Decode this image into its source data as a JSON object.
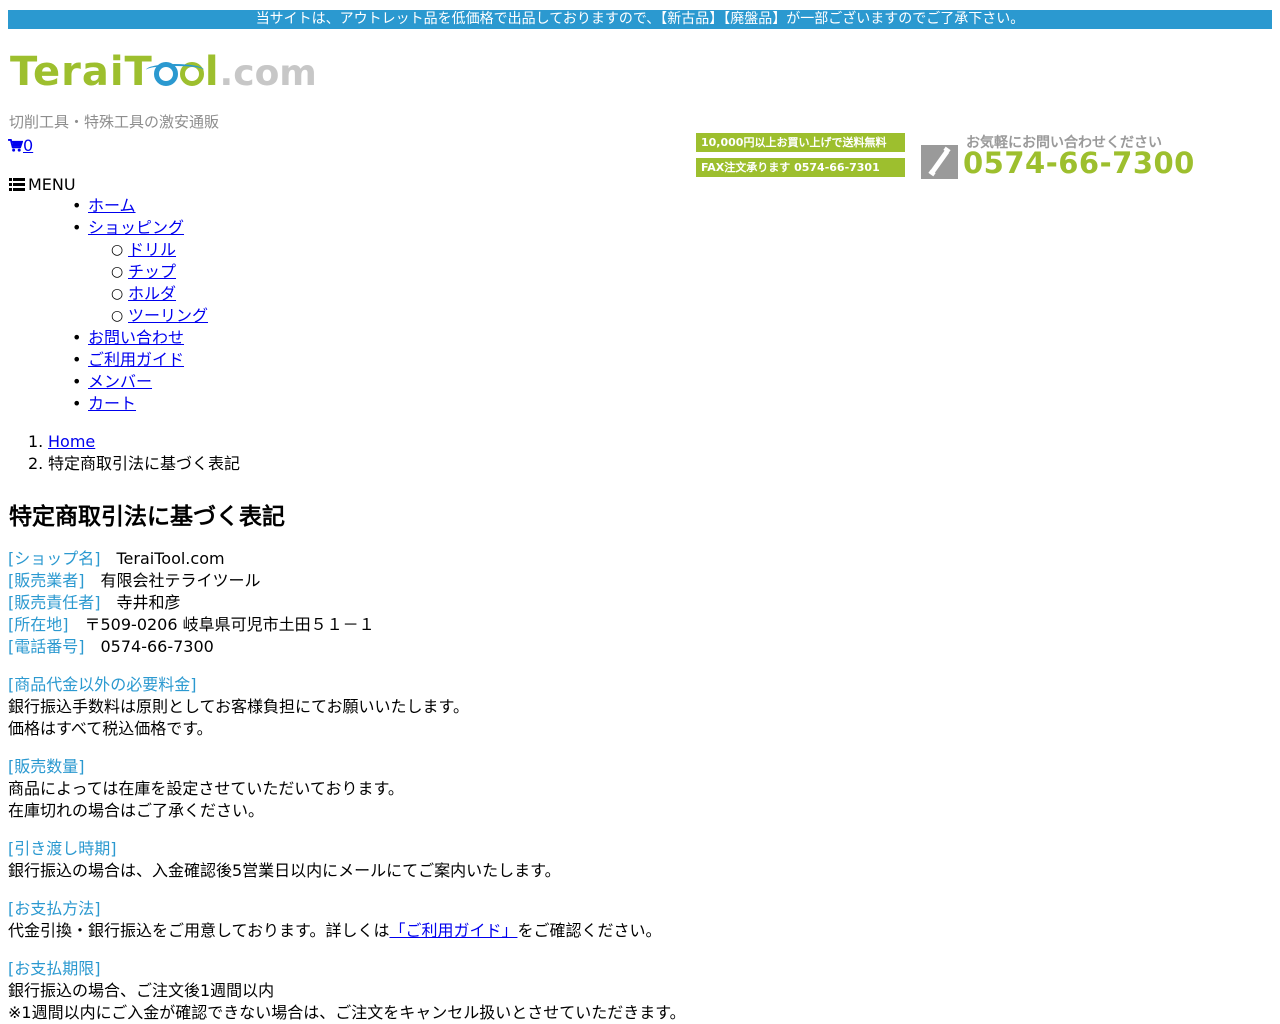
{
  "notice": "当サイトは、アウトレット品を低価格で出品しておりますので、【新古品】【廃盤品】が一部ございますのでご了承下さい。",
  "logo": {
    "part1": "Terai",
    "part2a": "T",
    "part2c": "l",
    "part3": ".com"
  },
  "tagline": "切削工具・特殊工具の激安通販",
  "cart": {
    "count": "0"
  },
  "banners": {
    "free_shipping": "10,000円以上お買い上げで送料無料",
    "fax": "FAX注文承ります 0574-66-7301"
  },
  "phone": {
    "caption": "お気軽にお問い合わせください",
    "number": "0574-66-7300"
  },
  "menu": {
    "toggle_label": "MENU",
    "items": [
      {
        "label": "ホーム"
      },
      {
        "label": "ショッピング",
        "children": [
          {
            "label": "ドリル"
          },
          {
            "label": "チップ"
          },
          {
            "label": "ホルダ"
          },
          {
            "label": "ツーリング"
          }
        ]
      },
      {
        "label": "お問い合わせ"
      },
      {
        "label": "ご利用ガイド"
      },
      {
        "label": "メンバー"
      },
      {
        "label": "カート"
      }
    ]
  },
  "breadcrumb": [
    {
      "num": "1.",
      "label": "Home"
    },
    {
      "num": "2.",
      "label": "特定商取引法に基づく表記"
    }
  ],
  "page_title": "特定商取引法に基づく表記",
  "info_rows": [
    {
      "label": "[ショップ名]",
      "value": "TeraiTool.com"
    },
    {
      "label": "[販売業者]",
      "value": "有限会社テライツール"
    },
    {
      "label": "[販売責任者]",
      "value": "寺井和彦"
    },
    {
      "label": "[所在地]",
      "value": "〒509-0206 岐阜県可児市土田５１－１"
    },
    {
      "label": "[電話番号]",
      "value": "0574-66-7300"
    }
  ],
  "sections": {
    "fees": {
      "heading": "[商品代金以外の必要料金]",
      "lines": [
        "銀行振込手数料は原則としてお客様負担にてお願いいたします。",
        "価格はすべて税込価格です。"
      ]
    },
    "quantity": {
      "heading": "[販売数量]",
      "lines": [
        "商品によっては在庫を設定させていただいております。",
        "在庫切れの場合はご了承ください。"
      ]
    },
    "delivery": {
      "heading": "[引き渡し時期]",
      "lines": [
        "銀行振込の場合は、入金確認後5営業日以内にメールにてご案内いたします。"
      ]
    },
    "payment": {
      "heading": "[お支払方法]",
      "text_before": "代金引換・銀行振込をご用意しております。詳しくは",
      "link": "「ご利用ガイド」",
      "text_after": "をご確認ください。"
    },
    "deadline": {
      "heading": "[お支払期限]",
      "lines": [
        "銀行振込の場合、ご注文後1週間以内",
        "※1週間以内にご入金が確認できない場合は、ご注文をキャンセル扱いとさせていただきます。"
      ]
    }
  }
}
